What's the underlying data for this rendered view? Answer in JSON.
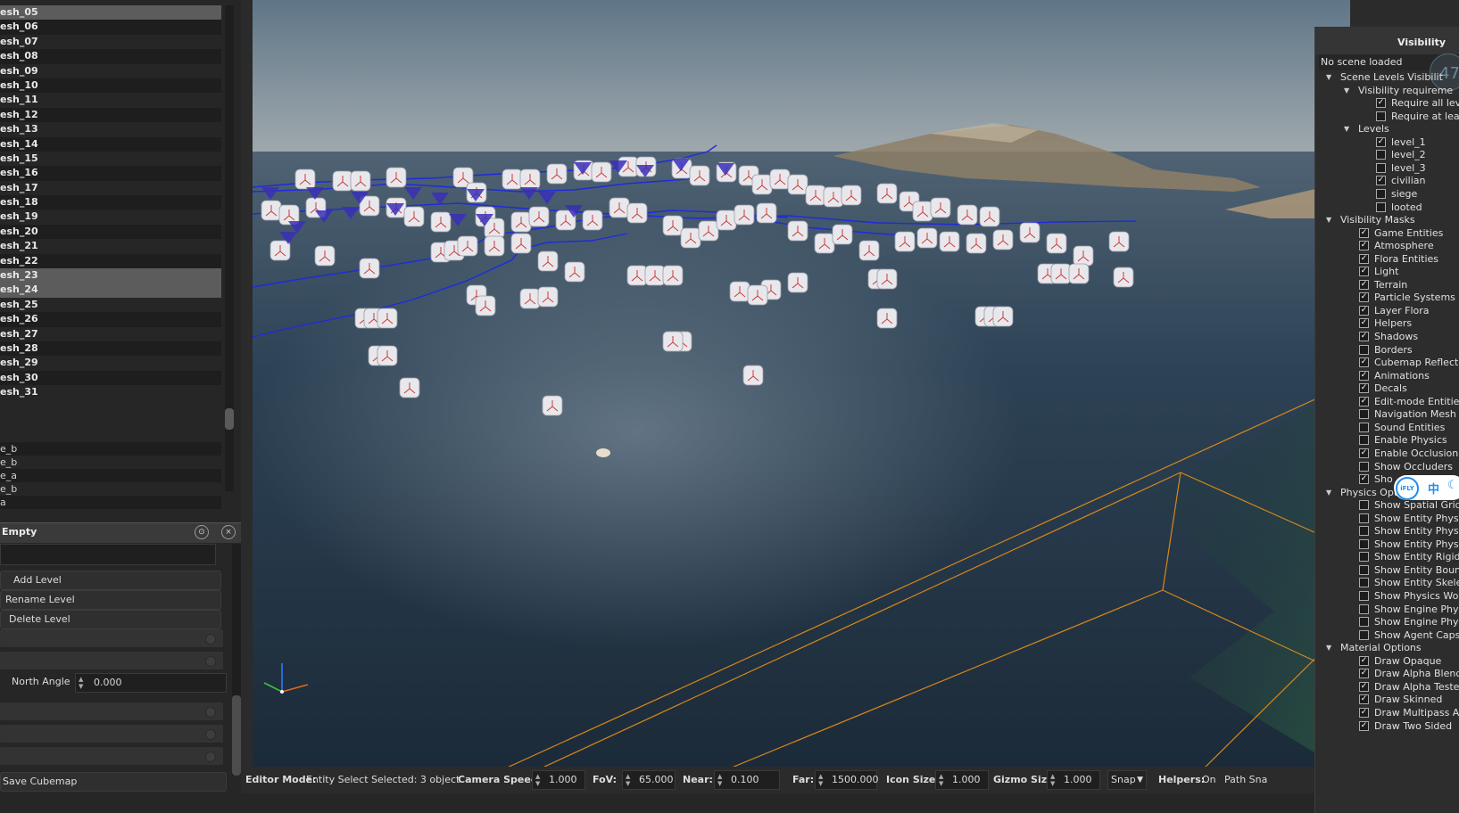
{
  "mesh_list": [
    "esh_05",
    "esh_06",
    "esh_07",
    "esh_08",
    "esh_09",
    "esh_10",
    "esh_11",
    "esh_12",
    "esh_13",
    "esh_14",
    "esh_15",
    "esh_16",
    "esh_17",
    "esh_18",
    "esh_19",
    "esh_20",
    "esh_21",
    "esh_22",
    "esh_23",
    "esh_24",
    "esh_25",
    "esh_26",
    "esh_27",
    "esh_28",
    "esh_29",
    "esh_30",
    "esh_31"
  ],
  "mesh_selected": [
    "esh_05",
    "esh_23",
    "esh_24"
  ],
  "small_list": [
    "e_b",
    "e_b",
    "e_a",
    "e_b",
    "a"
  ],
  "level_panel": {
    "title": "Empty",
    "add_level": "Add Level",
    "rename_level": "Rename Level",
    "delete_level": "Delete Level",
    "north_angle_label": "North Angle",
    "north_angle_value": "0.000",
    "save_cubemap": "Save Cubemap"
  },
  "status_bar": {
    "editor_mode_label": "Editor Mode:",
    "editor_mode_value": "Entity Select Selected: 3 object",
    "camera_speed_label": "Camera Speed:",
    "camera_speed": "1.000",
    "fov_label": "FoV:",
    "fov": "65.000",
    "near_label": "Near:",
    "near": "0.100",
    "far_label": "Far:",
    "far": "1500.000",
    "icon_size_label": "Icon Size:",
    "icon_size": "1.000",
    "gizmo_size_label": "Gizmo Size",
    "gizmo_size": "1.000",
    "snap": "Snap",
    "helpers_label": "Helpers:",
    "helpers_value": "On",
    "path_snap": "Path Sna"
  },
  "visibility": {
    "title": "Visibility",
    "subtitle": "No scene loaded",
    "fps_badge": "47",
    "items": [
      {
        "label": "Scene Levels Visibilit",
        "type": "group",
        "indent": 0,
        "checked": null
      },
      {
        "label": "Visibility requireme",
        "type": "group",
        "indent": 1,
        "checked": null
      },
      {
        "label": "Require all lev",
        "type": "item",
        "indent": 3,
        "checked": true
      },
      {
        "label": "Require at leas",
        "type": "item",
        "indent": 3,
        "checked": false
      },
      {
        "label": "Levels",
        "type": "group",
        "indent": 1,
        "checked": null
      },
      {
        "label": "level_1",
        "type": "item",
        "indent": 3,
        "checked": true
      },
      {
        "label": "level_2",
        "type": "item",
        "indent": 3,
        "checked": false
      },
      {
        "label": "level_3",
        "type": "item",
        "indent": 3,
        "checked": false
      },
      {
        "label": "civilian",
        "type": "item",
        "indent": 3,
        "checked": true
      },
      {
        "label": "siege",
        "type": "item",
        "indent": 3,
        "checked": false
      },
      {
        "label": "looted",
        "type": "item",
        "indent": 3,
        "checked": false
      },
      {
        "label": "Visibility Masks",
        "type": "group",
        "indent": 0,
        "checked": null
      },
      {
        "label": "Game Entities",
        "type": "item",
        "indent": 2,
        "checked": true
      },
      {
        "label": "Atmosphere",
        "type": "item",
        "indent": 2,
        "checked": true
      },
      {
        "label": "Flora Entities",
        "type": "item",
        "indent": 2,
        "checked": true
      },
      {
        "label": "Light",
        "type": "item",
        "indent": 2,
        "checked": true
      },
      {
        "label": "Terrain",
        "type": "item",
        "indent": 2,
        "checked": true
      },
      {
        "label": "Particle Systems",
        "type": "item",
        "indent": 2,
        "checked": true
      },
      {
        "label": "Layer Flora",
        "type": "item",
        "indent": 2,
        "checked": true
      },
      {
        "label": "Helpers",
        "type": "item",
        "indent": 2,
        "checked": true
      },
      {
        "label": "Shadows",
        "type": "item",
        "indent": 2,
        "checked": true
      },
      {
        "label": "Borders",
        "type": "item",
        "indent": 2,
        "checked": false
      },
      {
        "label": "Cubemap Reflecto",
        "type": "item",
        "indent": 2,
        "checked": true
      },
      {
        "label": "Animations",
        "type": "item",
        "indent": 2,
        "checked": true
      },
      {
        "label": "Decals",
        "type": "item",
        "indent": 2,
        "checked": true
      },
      {
        "label": "Edit-mode Entities",
        "type": "item",
        "indent": 2,
        "checked": true
      },
      {
        "label": "Navigation Mesh",
        "type": "item",
        "indent": 2,
        "checked": false
      },
      {
        "label": "Sound Entities",
        "type": "item",
        "indent": 2,
        "checked": false
      },
      {
        "label": "Enable Physics",
        "type": "item",
        "indent": 2,
        "checked": false
      },
      {
        "label": "Enable Occlusion",
        "type": "item",
        "indent": 2,
        "checked": true
      },
      {
        "label": "Show Occluders",
        "type": "item",
        "indent": 2,
        "checked": false
      },
      {
        "label": "Sho",
        "type": "item",
        "indent": 2,
        "checked": true
      },
      {
        "label": "Physics Options",
        "type": "group",
        "indent": 0,
        "checked": null
      },
      {
        "label": "Show Spatial Grid",
        "type": "item",
        "indent": 2,
        "checked": false
      },
      {
        "label": "Show Entity Physic",
        "type": "item",
        "indent": 2,
        "checked": false
      },
      {
        "label": "Show Entity Physic",
        "type": "item",
        "indent": 2,
        "checked": false
      },
      {
        "label": "Show Entity Physic",
        "type": "item",
        "indent": 2,
        "checked": false
      },
      {
        "label": "Show Entity Rigid",
        "type": "item",
        "indent": 2,
        "checked": false
      },
      {
        "label": "Show Entity Boun",
        "type": "item",
        "indent": 2,
        "checked": false
      },
      {
        "label": "Show Entity Skelet",
        "type": "item",
        "indent": 2,
        "checked": false
      },
      {
        "label": "Show Physics Wor",
        "type": "item",
        "indent": 2,
        "checked": false
      },
      {
        "label": "Show Engine Phys",
        "type": "item",
        "indent": 2,
        "checked": false
      },
      {
        "label": "Show Engine Phys",
        "type": "item",
        "indent": 2,
        "checked": false
      },
      {
        "label": "Show Agent Capsu",
        "type": "item",
        "indent": 2,
        "checked": false
      },
      {
        "label": "Material Options",
        "type": "group",
        "indent": 0,
        "checked": null
      },
      {
        "label": "Draw Opaque",
        "type": "item",
        "indent": 2,
        "checked": true
      },
      {
        "label": "Draw Alpha Blend",
        "type": "item",
        "indent": 2,
        "checked": true
      },
      {
        "label": "Draw Alpha Tested",
        "type": "item",
        "indent": 2,
        "checked": true
      },
      {
        "label": "Draw Skinned",
        "type": "item",
        "indent": 2,
        "checked": true
      },
      {
        "label": "Draw Multipass Al",
        "type": "item",
        "indent": 2,
        "checked": true
      },
      {
        "label": "Draw Two Sided",
        "type": "item",
        "indent": 2,
        "checked": true
      }
    ]
  },
  "ime_toolbar": {
    "logo": "iFLY",
    "char": "中"
  },
  "colors": {
    "accent_blue": "#1f2bdc",
    "bounds_orange": "#d8861a",
    "panel_bg": "#2d2d2d"
  }
}
